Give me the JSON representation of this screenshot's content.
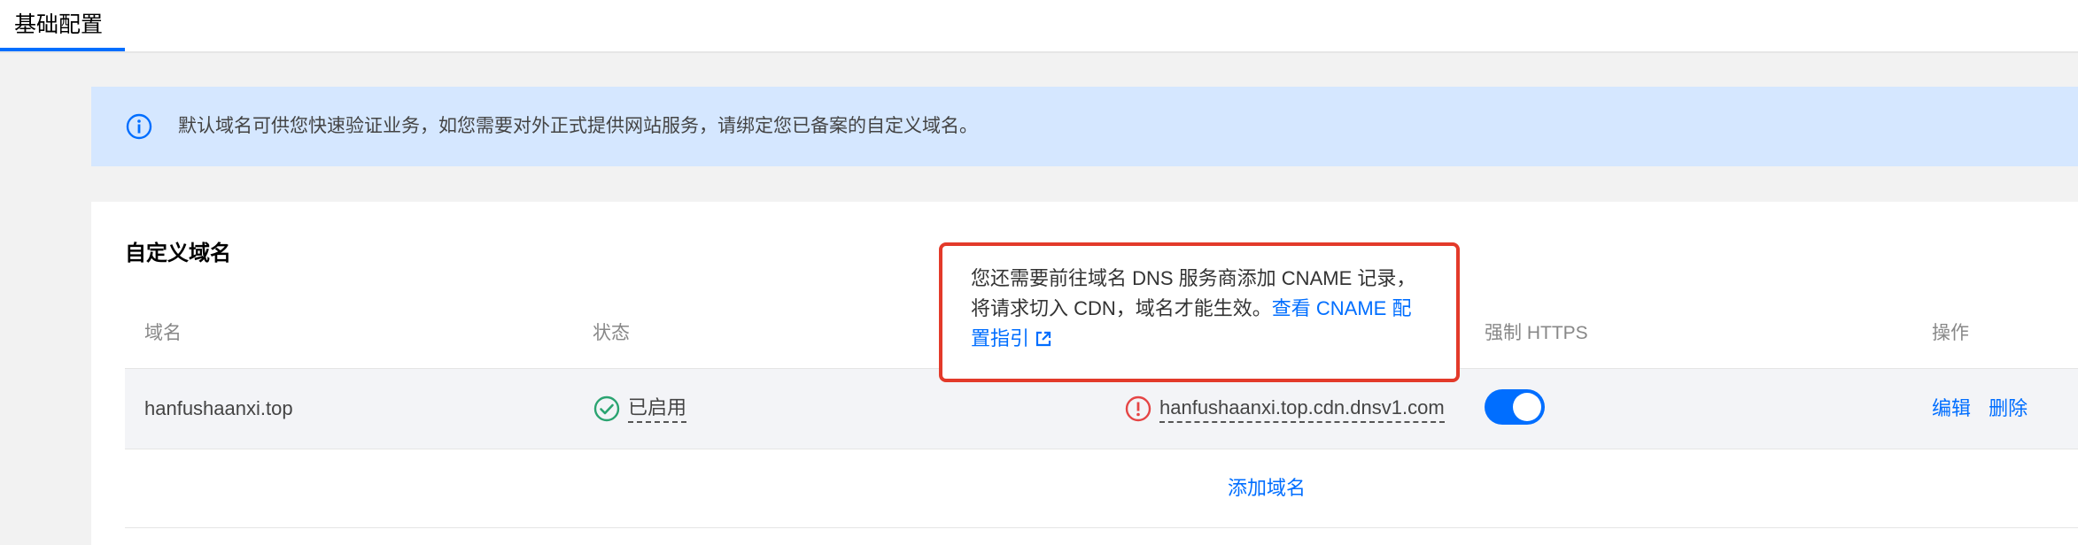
{
  "tabs": {
    "active": "基础配置"
  },
  "banner": {
    "icon": "info-icon",
    "text": "默认域名可供您快速验证业务，如您需要对外正式提供网站服务，请绑定您已备案的自定义域名。"
  },
  "section": {
    "title": "自定义域名"
  },
  "table": {
    "headers": {
      "domain": "域名",
      "status": "状态",
      "https": "强制 HTTPS",
      "ops": "操作"
    },
    "row": {
      "domain": "hanfushaanxi.top",
      "status": "已启用",
      "cname": "hanfushaanxi.top.cdn.dnsv1.com",
      "https_enabled": true,
      "edit": "编辑",
      "delete": "删除"
    },
    "add_label": "添加域名"
  },
  "tooltip": {
    "line1": "您还需要前往域名 DNS 服务商添加 CNAME 记录，",
    "line2_prefix": "将请求切入 CDN，域名才能生效。",
    "link_part1": "查看 CNAME 配",
    "link_part2": "置指引"
  },
  "colors": {
    "accent": "#006eff",
    "success": "#2ba471",
    "danger": "#e54545",
    "highlight_border": "#e33a2a"
  }
}
